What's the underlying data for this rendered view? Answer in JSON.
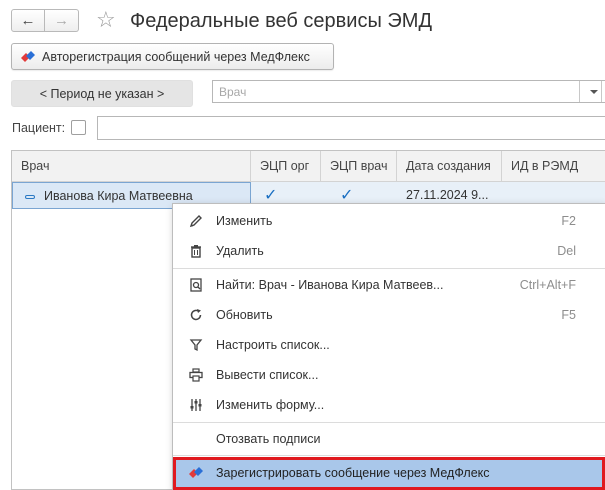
{
  "window": {
    "title": "Федеральные веб сервисы ЭМД"
  },
  "toolbar": {
    "autoreg_label": "Авторегистрация сообщений через МедФлекс",
    "period_label": "< Период не указан >",
    "doctor_placeholder": "Врач"
  },
  "filter": {
    "patient_label": "Пациент:"
  },
  "table": {
    "columns": [
      "Врач",
      "ЭЦП орг",
      "ЭЦП врач",
      "Дата создания",
      "ИД в РЭМД"
    ],
    "rows": [
      {
        "doctor": "Иванова Кира Матвеевна",
        "sig_org": "✓",
        "sig_doc": "✓",
        "created": "27.11.2024 9...",
        "remd_id": ""
      }
    ]
  },
  "context_menu": {
    "items": [
      {
        "label": "Изменить",
        "shortcut": "F2",
        "icon": "pencil-icon"
      },
      {
        "label": "Удалить",
        "shortcut": "Del",
        "icon": "trash-icon"
      },
      {
        "label": "Найти: Врач - Иванова Кира Матвеев...",
        "shortcut": "Ctrl+Alt+F",
        "icon": "find-icon"
      },
      {
        "label": "Обновить",
        "shortcut": "F5",
        "icon": "refresh-icon"
      },
      {
        "label": "Настроить список...",
        "shortcut": "",
        "icon": "filter-icon"
      },
      {
        "label": "Вывести список...",
        "shortcut": "",
        "icon": "printer-icon"
      },
      {
        "label": "Изменить форму...",
        "shortcut": "",
        "icon": "sliders-icon"
      },
      {
        "label": "Отозвать подписи",
        "shortcut": "",
        "icon": ""
      },
      {
        "label": "Зарегистрировать сообщение через МедФлекс",
        "shortcut": "",
        "icon": "medflex-icon"
      }
    ]
  },
  "colors": {
    "accent_blue": "#1b6fc2",
    "selection": "#a9c7ea",
    "highlight_border": "#e0191f"
  }
}
